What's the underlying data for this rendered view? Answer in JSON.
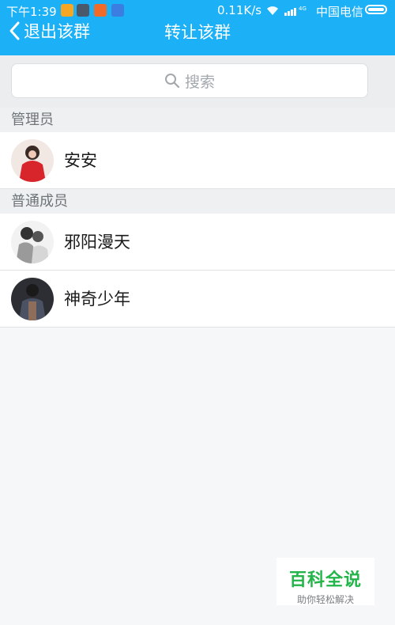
{
  "status_bar": {
    "time": "下午1:39",
    "network_speed": "0.11K/s",
    "signal_label": "4G",
    "carrier": "中国电信",
    "notification_icons": [
      "app-icon-1",
      "app-icon-2",
      "app-icon-3",
      "app-icon-4"
    ]
  },
  "nav": {
    "back_label": "退出该群",
    "title": "转让该群"
  },
  "search": {
    "placeholder": "搜索"
  },
  "sections": {
    "admins": {
      "header": "管理员",
      "members": [
        {
          "name": "安安",
          "avatar": "avatar-red-dress"
        }
      ]
    },
    "regular": {
      "header": "普通成员",
      "members": [
        {
          "name": "邪阳漫天",
          "avatar": "avatar-couple-bw"
        },
        {
          "name": "神奇少年",
          "avatar": "avatar-dark-boy"
        }
      ]
    }
  },
  "watermark": {
    "title": "百科全说",
    "subtitle": "助你轻松解决"
  },
  "colors": {
    "header_bg": "#1cb0f6",
    "page_bg": "#f6f7f8",
    "section_bg": "#eef0f2",
    "watermark_green": "#23b44a"
  }
}
